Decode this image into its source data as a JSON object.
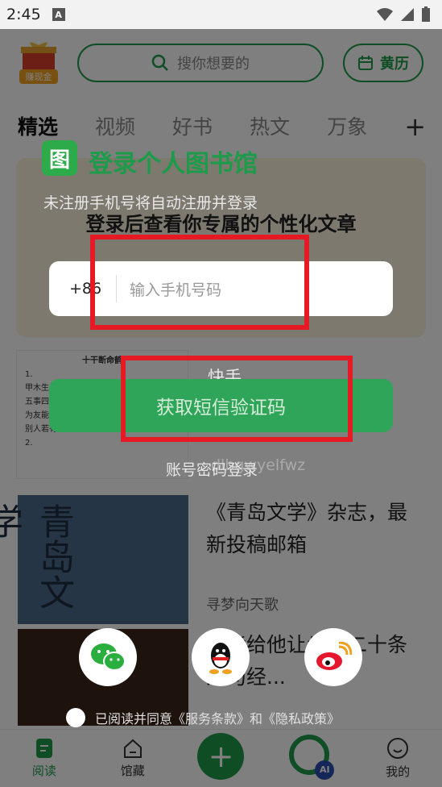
{
  "status": {
    "time": "2:45",
    "a_badge": "A"
  },
  "header": {
    "logo_tag": "赚现金",
    "search_placeholder": "搜你想要的",
    "calendar_label": "黄历"
  },
  "tabs": [
    "精选",
    "视频",
    "好书",
    "热文",
    "万象"
  ],
  "feed": {
    "promo_title": "登录后查看你专属的个性化文章",
    "doc_lines": [
      "十干断命鹤",
      "1.",
      "甲木生人最爱明，深谋",
      "五事四柱交图支，状",
      "为友能害贵静马，秀数",
      "别人若有为难事，合己为人也谅或。",
      "2."
    ],
    "article1_title": "《青岛文学》杂志，最新投稿邮箱",
    "article1_author": "寻梦向天歌",
    "article1_calligraphy": "青岛文学",
    "article2_title": "不能给他让步！二十条人句经..."
  },
  "nav": {
    "read": "阅读",
    "collection": "馆藏",
    "add": "+",
    "ai_badge": "AI",
    "mine": "我的"
  },
  "login": {
    "logo_char": "图",
    "title": "登录个人图书馆",
    "hint": "未注册手机号将自动注册并登录",
    "country_code": "+86",
    "phone_placeholder": "输入手机号码",
    "sms_button": "获取短信验证码",
    "kuaishou": "快手",
    "password_login": "账号密码登录",
    "faint_id": "dlbgwyelfwz",
    "agree_text": "已阅读并同意《服务条款》和《隐私政策》"
  },
  "colors": {
    "brand": "#1e9b4a",
    "highlight": "#e51a24"
  }
}
